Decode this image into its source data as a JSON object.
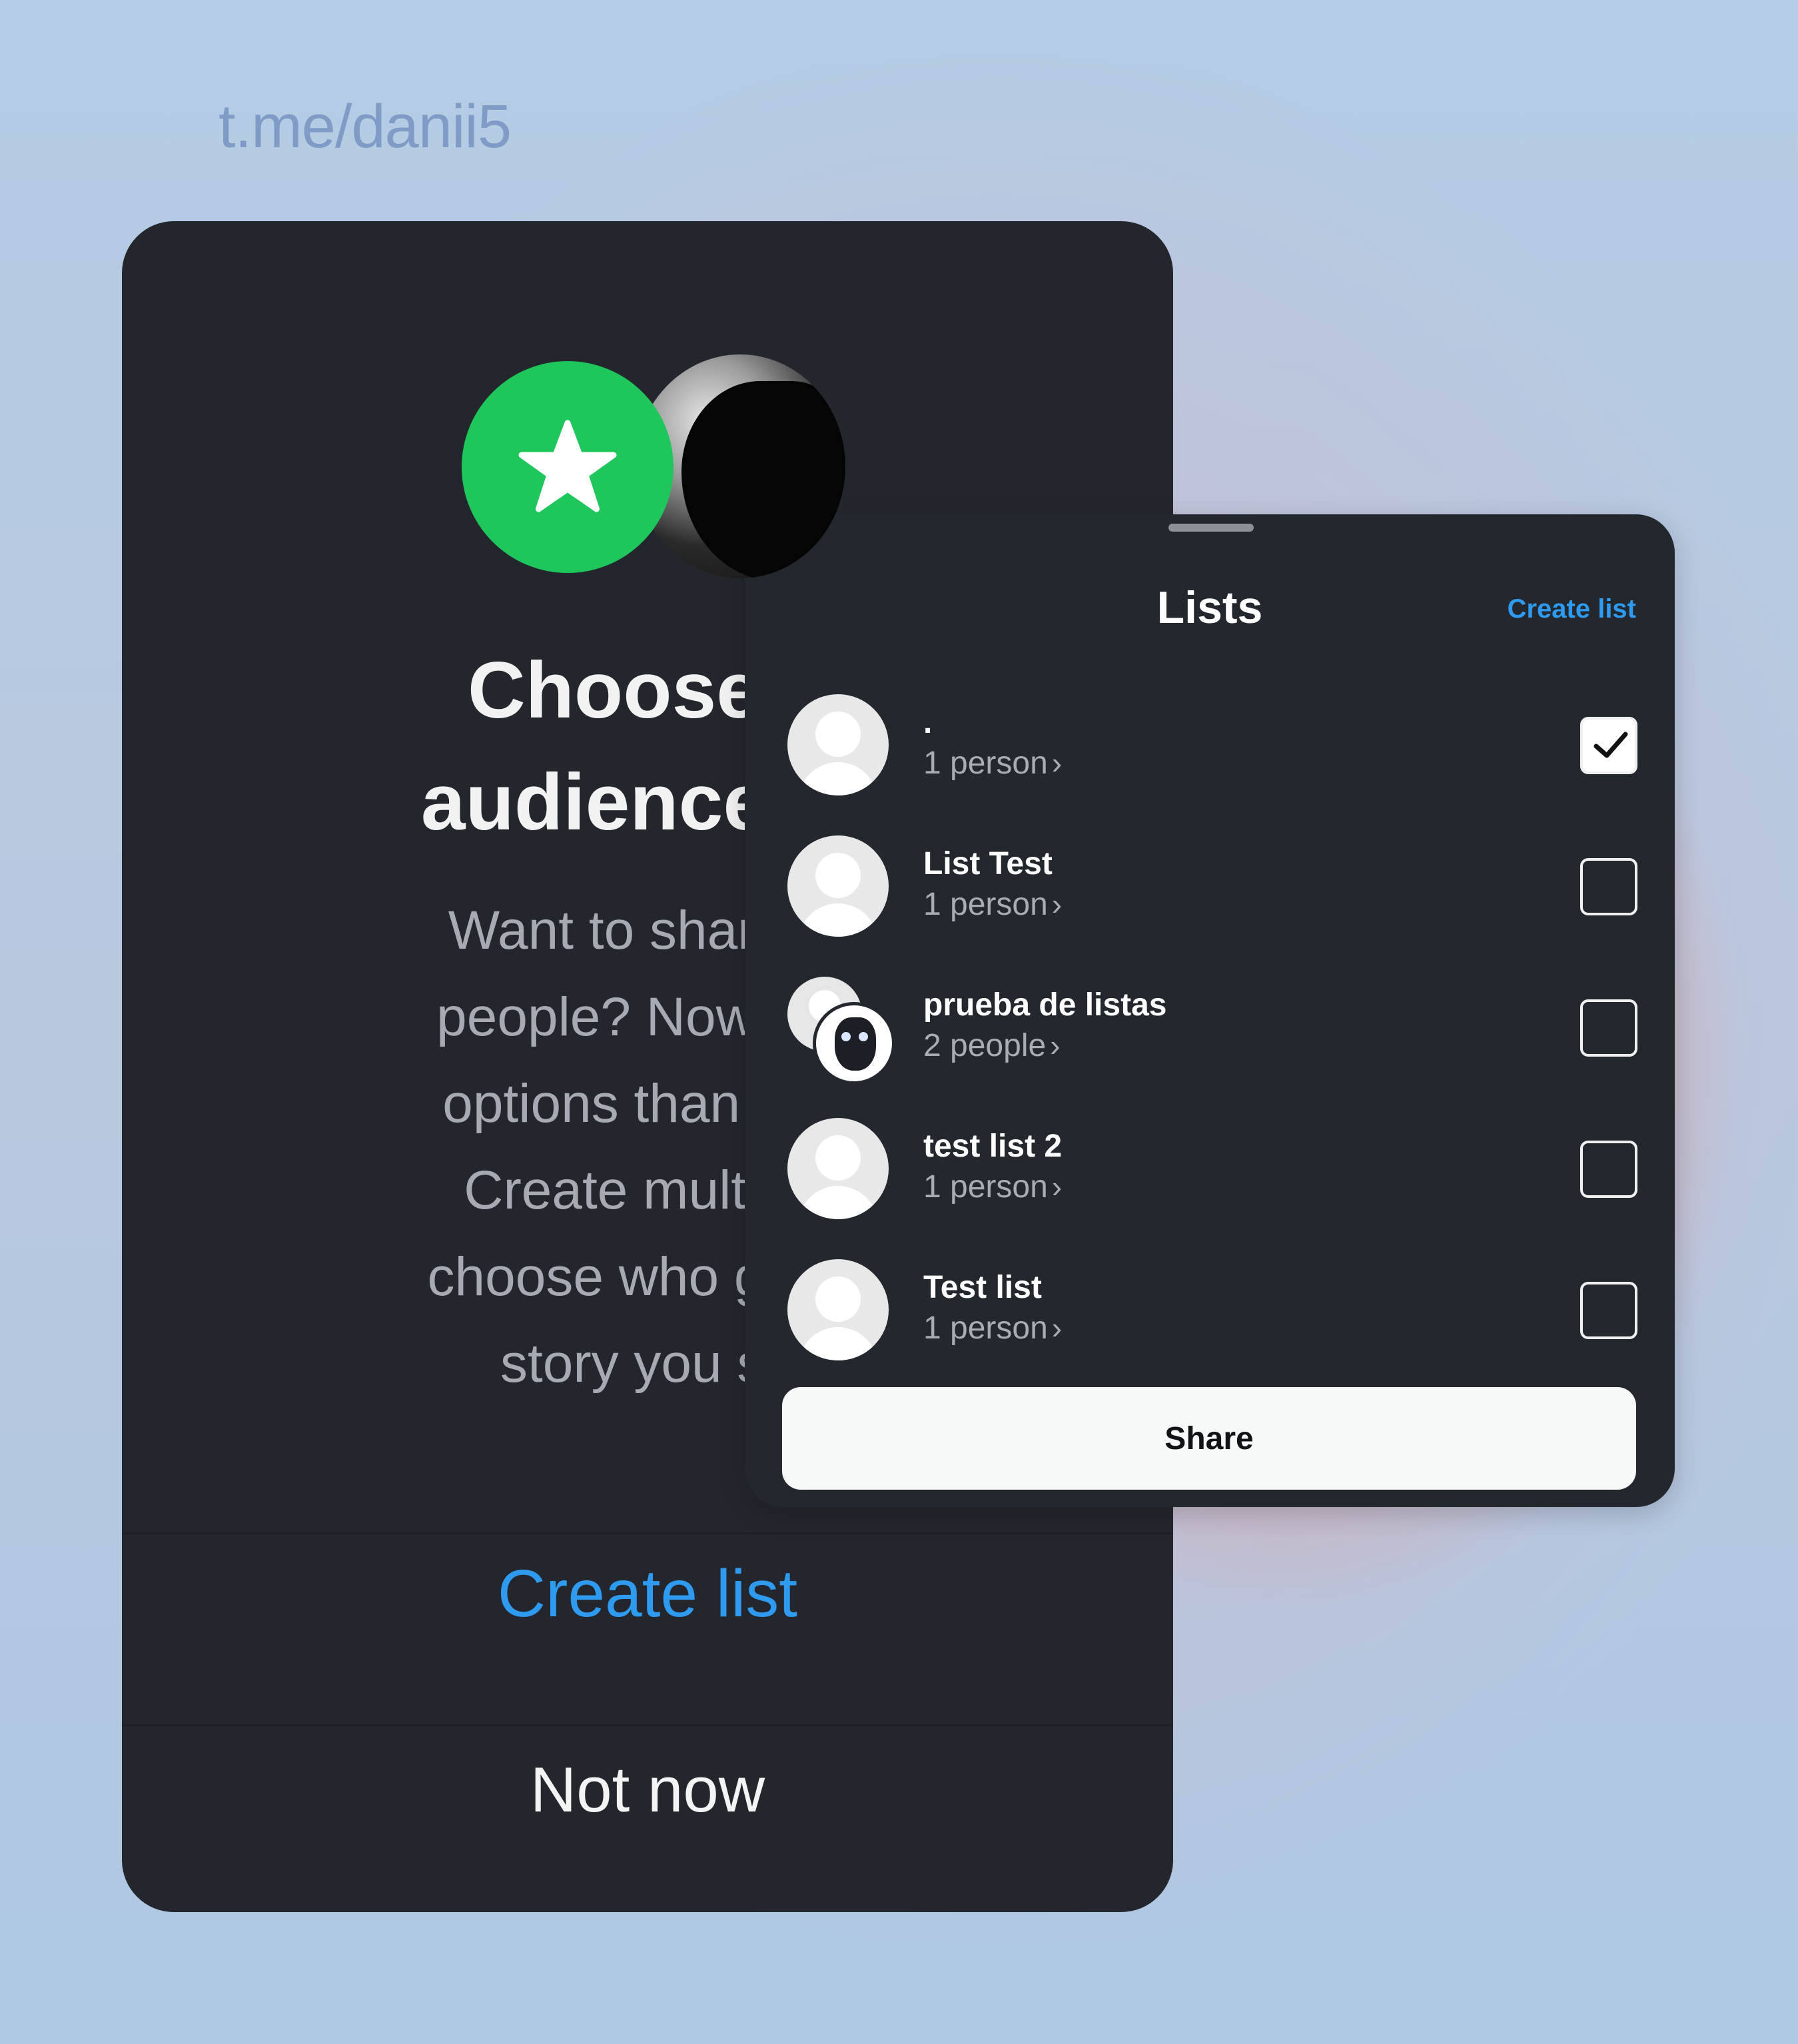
{
  "watermark": "t.me/danii5",
  "back_card": {
    "title_line1": "Choose y",
    "title_line2": "audience wi",
    "body_lines": [
      "Want to share to",
      "people? Now you",
      "options than clos",
      "Create multiple",
      "choose who gets t",
      "story you sh"
    ],
    "create_list": "Create list",
    "not_now": "Not now",
    "badge_color": "#1fc65c"
  },
  "sheet": {
    "title": "Lists",
    "create_list": "Create list",
    "accent_color": "#2e9bf0",
    "lists": [
      {
        "name": ".",
        "count": "1 person",
        "checked": true,
        "avatar": "default-avatar"
      },
      {
        "name": "List Test",
        "count": "1 person",
        "checked": false,
        "avatar": "default-avatar"
      },
      {
        "name": "prueba de listas",
        "count": "2 people",
        "checked": false,
        "avatar": "group-avatar"
      },
      {
        "name": "test list 2",
        "count": "1 person",
        "checked": false,
        "avatar": "default-avatar"
      },
      {
        "name": "Test list",
        "count": "1 person",
        "checked": false,
        "avatar": "default-avatar"
      }
    ],
    "chevron": "›",
    "share_label": "Share"
  }
}
